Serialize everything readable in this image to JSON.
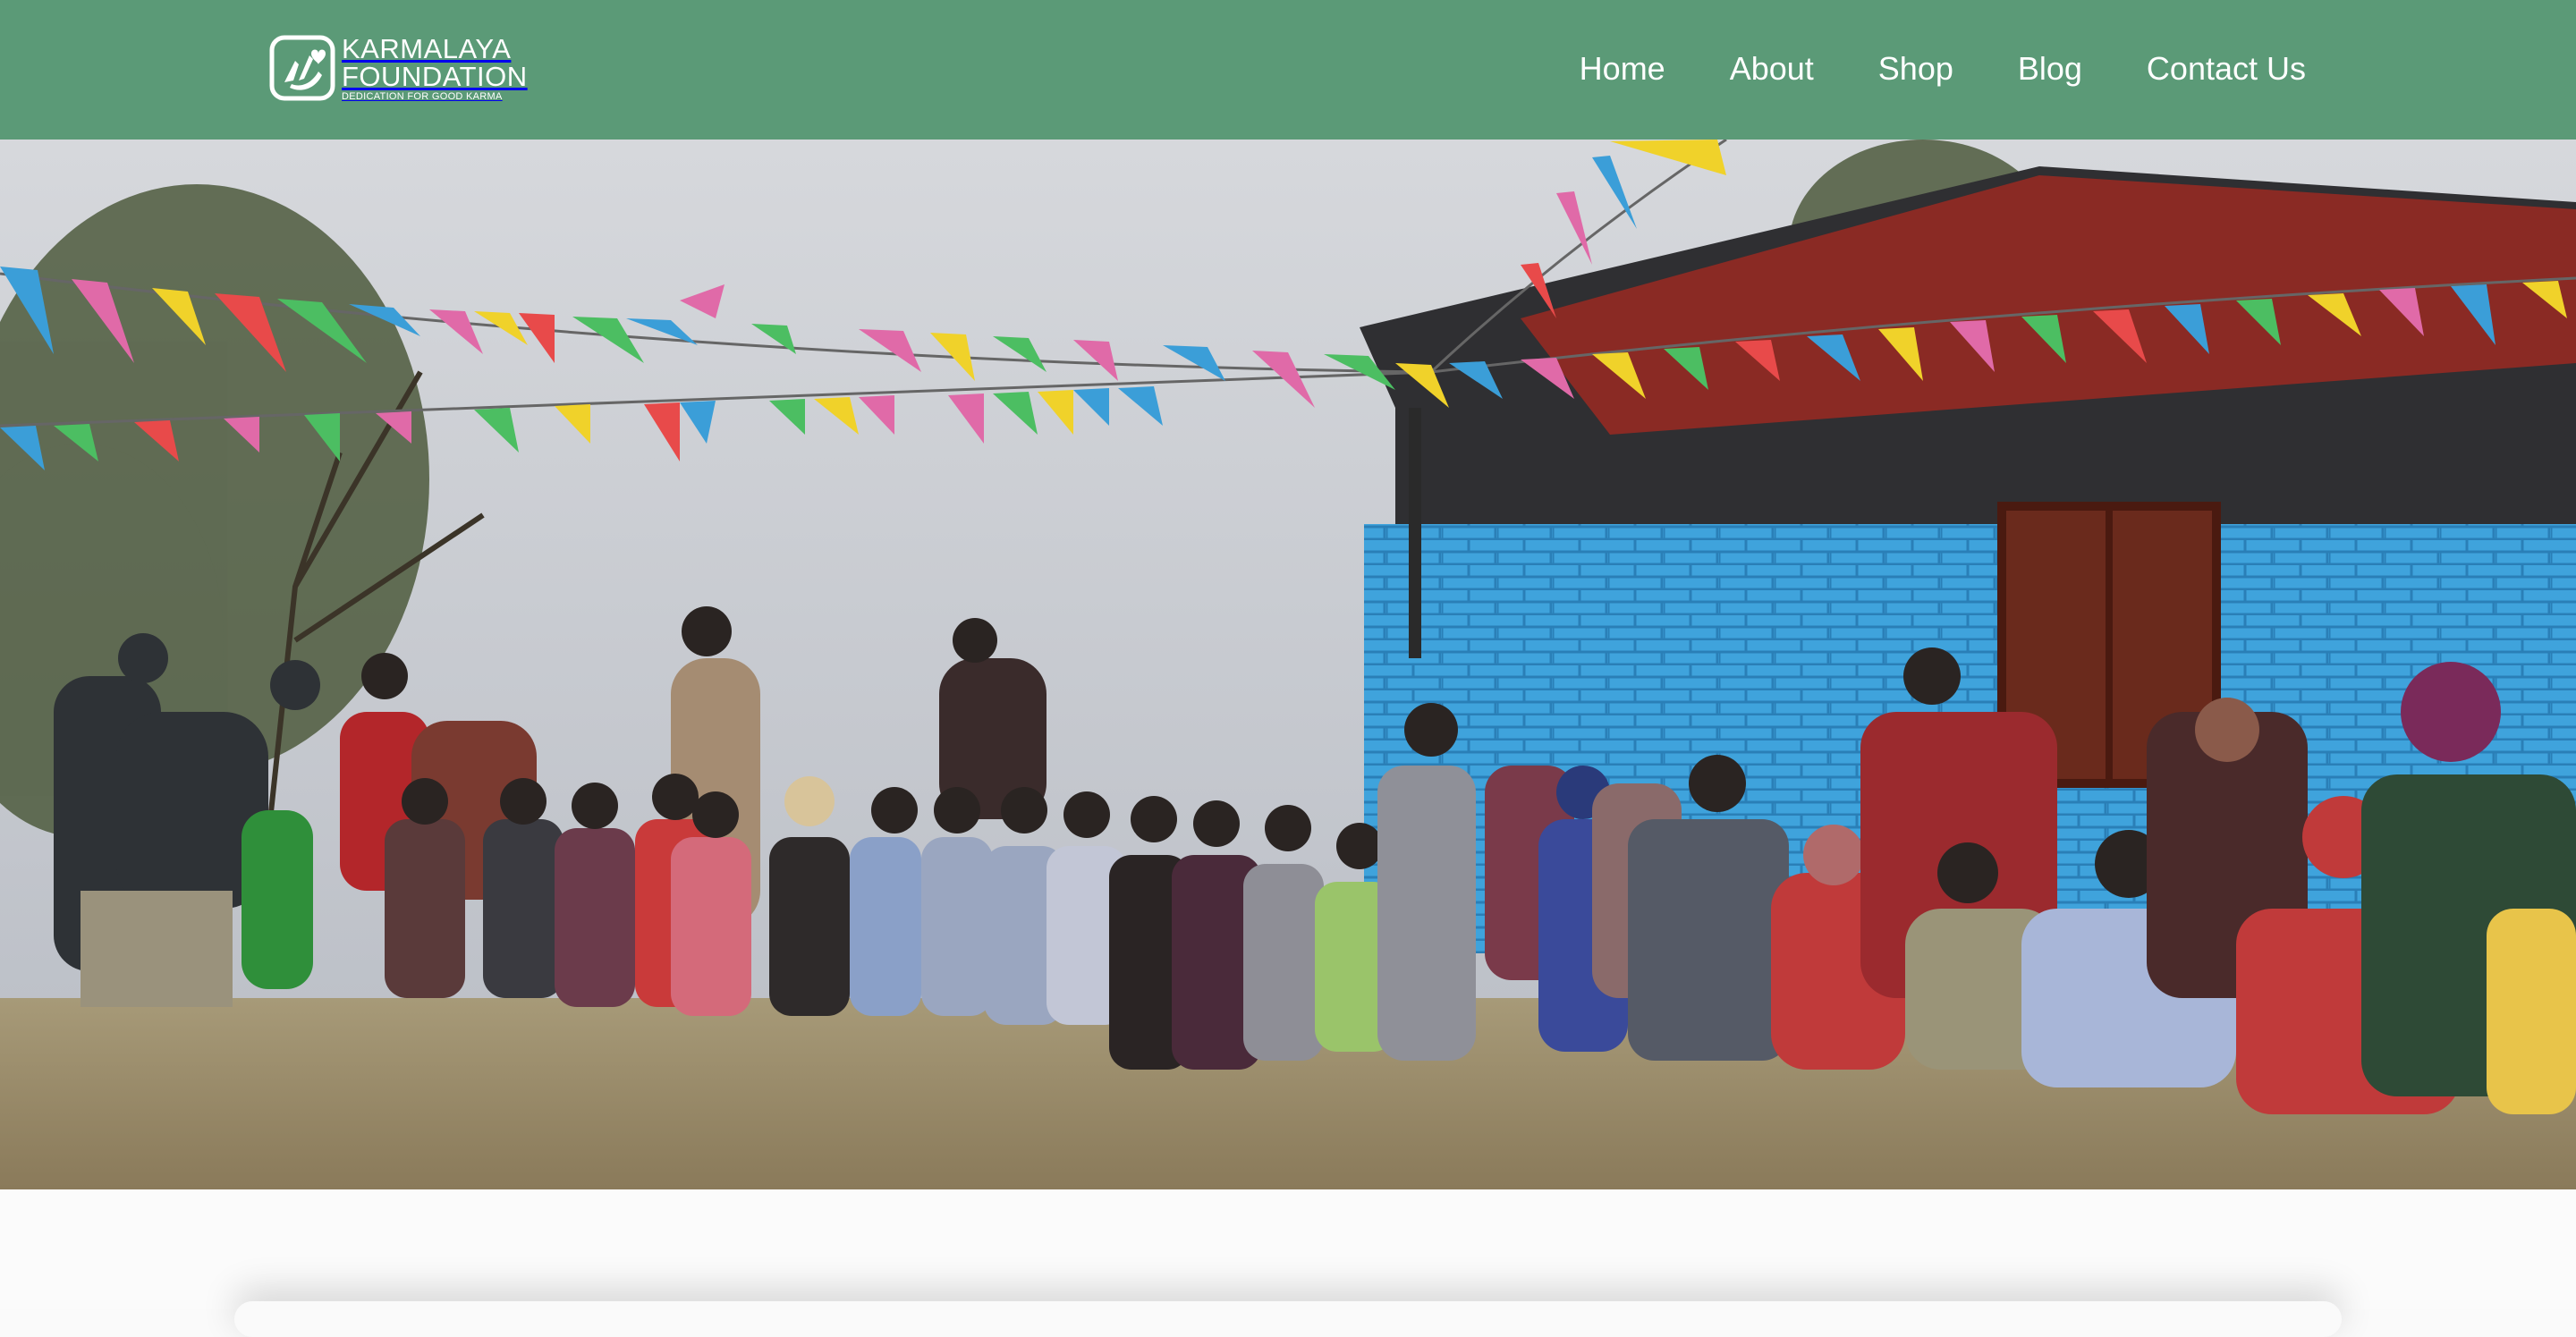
{
  "header": {
    "logo": {
      "line1": "KARMALAYA",
      "line2": "FOUNDATION",
      "tagline": "DEDICATION FOR GOOD KARMA",
      "icon": "hands-heart-icon"
    },
    "nav": [
      {
        "label": "Home"
      },
      {
        "label": "About"
      },
      {
        "label": "Shop"
      },
      {
        "label": "Blog"
      },
      {
        "label": "Contact Us"
      }
    ]
  },
  "hero": {
    "image_kind": "photograph"
  },
  "colors": {
    "header_bg": "#5b9a77",
    "nav_text": "#ffffff",
    "page_bg": "#fafafa"
  }
}
